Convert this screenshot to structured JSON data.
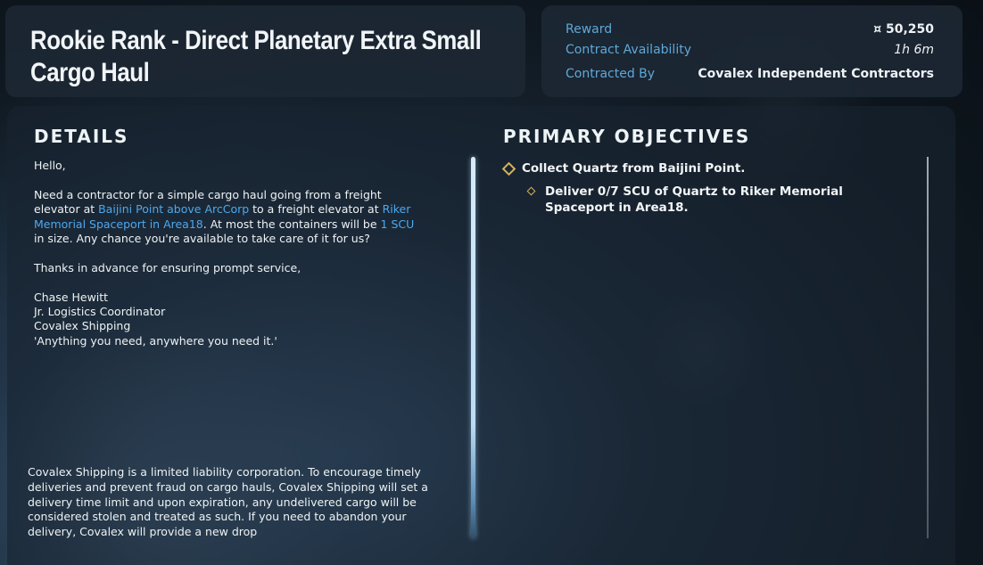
{
  "contract": {
    "title": "Rookie Rank - Direct Planetary Extra Small Cargo Haul"
  },
  "info": {
    "reward_label": "Reward",
    "reward_value": "¤ 50,250",
    "availability_label": "Contract Availability",
    "availability_value": "1h 6m",
    "contracted_by_label": "Contracted By",
    "contracted_by_value": "Covalex Independent Contractors"
  },
  "details": {
    "heading": "DETAILS",
    "greeting": "Hello,",
    "p1_a": "Need a contractor for a simple cargo haul going from a freight elevator at ",
    "p1_loc1": "Baijini Point above ArcCorp",
    "p1_b": " to a freight elevator at ",
    "p1_loc2": "Riker Memorial Spaceport in Area18",
    "p1_c": ". At most the containers will be ",
    "p1_size": "1 SCU",
    "p1_d": " in size. Any chance you're available to take care of it for us?",
    "thanks": "Thanks in advance for ensuring prompt service,",
    "sig_name": "Chase Hewitt",
    "sig_title": "Jr. Logistics Coordinator",
    "sig_company": "Covalex Shipping",
    "sig_motto": "'Anything you need, anywhere you need it.'",
    "legal": "Covalex Shipping is a limited liability corporation. To encourage timely deliveries and prevent fraud on cargo hauls, Covalex Shipping will set a delivery time limit and upon expiration, any undelivered cargo will be considered stolen and treated as such. If you need to abandon your delivery, Covalex will provide a new drop"
  },
  "objectives": {
    "heading": "PRIMARY OBJECTIVES",
    "items": [
      {
        "text": "Collect Quartz from Baijini Point."
      },
      {
        "text": "Deliver 0/7 SCU of Quartz to Riker Memorial Spaceport in Area18."
      }
    ]
  },
  "colors": {
    "accent": "#5fa8d8",
    "highlight": "#4ea8ee",
    "objective_marker": "#d7b25c"
  }
}
